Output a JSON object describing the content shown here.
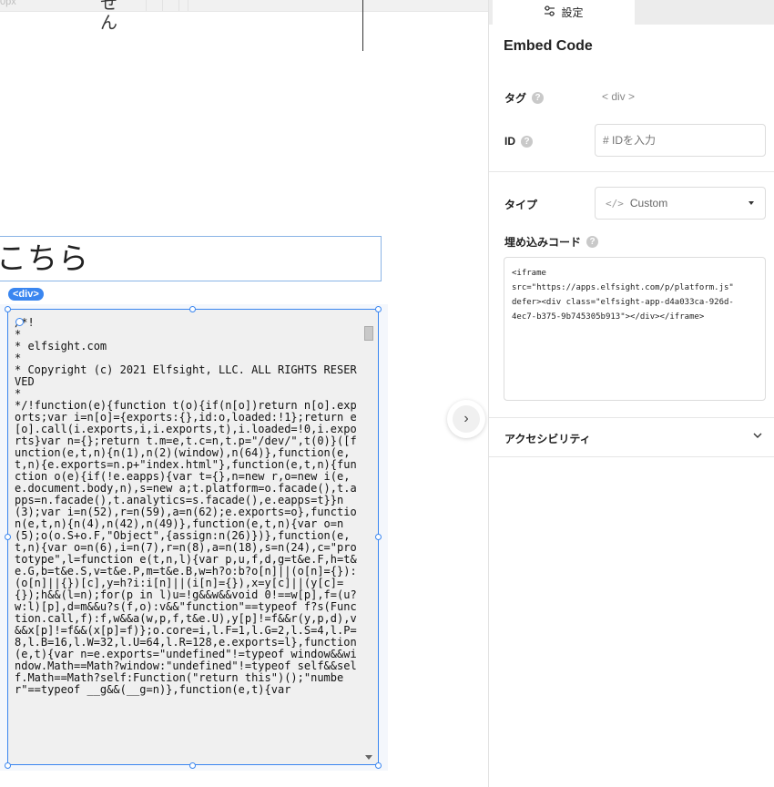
{
  "canvas": {
    "top_units": "0px",
    "kana_fragment": "せ\nん",
    "heading_text": "こちら",
    "element_tag": "<div>",
    "embed_code": "/*!\n*\n* elfsight.com\n*\n* Copyright (c) 2021 Elfsight, LLC. ALL RIGHTS RESERVED\n*\n*/!function(e){function t(o){if(n[o])return n[o].exports;var i=n[o]={exports:{},id:o,loaded:!1};return e[o].call(i.exports,i,i.exports,t),i.loaded=!0,i.exports}var n={};return t.m=e,t.c=n,t.p=\"/dev/\",t(0)}([function(e,t,n){n(1),n(2)(window),n(64)},function(e,t,n){e.exports=n.p+\"index.html\"},function(e,t,n){function o(e){if(!e.eapps){var t={},n=new r,o=new i(e,e.document.body,n),s=new a;t.platform=o.facade(),t.apps=n.facade(),t.analytics=s.facade(),e.eapps=t}}n(3);var i=n(52),r=n(59),a=n(62);e.exports=o},function(e,t,n){n(4),n(42),n(49)},function(e,t,n){var o=n(5);o(o.S+o.F,\"Object\",{assign:n(26)})},function(e,t,n){var o=n(6),i=n(7),r=n(8),a=n(18),s=n(24),c=\"prototype\",l=function e(t,n,l){var p,u,f,d,g=t&e.F,h=t&e.G,b=t&e.S,v=t&e.P,m=t&e.B,w=h?o:b?o[n]||(o[n]={}):(o[n]||{})[c],y=h?i:i[n]||(i[n]={}),x=y[c]||(y[c]={});h&&(l=n);for(p in l)u=!g&&w&&void 0!==w[p],f=(u?w:l)[p],d=m&&u?s(f,o):v&&\"function\"==typeof f?s(Function.call,f):f,w&&a(w,p,f,t&e.U),y[p]!=f&&r(y,p,d),v&&x[p]!=f&&(x[p]=f)};o.core=i,l.F=1,l.G=2,l.S=4,l.P=8,l.B=16,l.W=32,l.U=64,l.R=128,e.exports=l},function(e,t){var n=e.exports=\"undefined\"!=typeof window&&window.Math==Math?window:\"undefined\"!=typeof self&&self.Math==Math?self:Function(\"return this\")();\"number\"==typeof __g&&(__g=n)},function(e,t){var"
  },
  "panel": {
    "tab_label": "設定",
    "title": "Embed Code",
    "tag_label": "タグ",
    "tag_value": "< div >",
    "id_label": "ID",
    "id_placeholder": "# IDを入力",
    "type_label": "タイプ",
    "type_value": "Custom",
    "embed_label": "埋め込みコード",
    "embed_value": "<iframe\nsrc=\"https://apps.elfsight.com/p/platform.js\"\ndefer><div class=\"elfsight-app-d4a033ca-926d-\n4ec7-b375-9b745305b913\"></div></iframe>",
    "accessibility_label": "アクセシビリティ"
  },
  "icons": {
    "sliders": "sliders-icon",
    "help": "help-icon",
    "code": "code-icon",
    "caret": "caret-down-icon",
    "chevron": "chevron-down-icon",
    "expand": "chevron-right-icon"
  },
  "colors": {
    "accent": "#3a86f0",
    "heading_border": "#8ab4e6"
  }
}
